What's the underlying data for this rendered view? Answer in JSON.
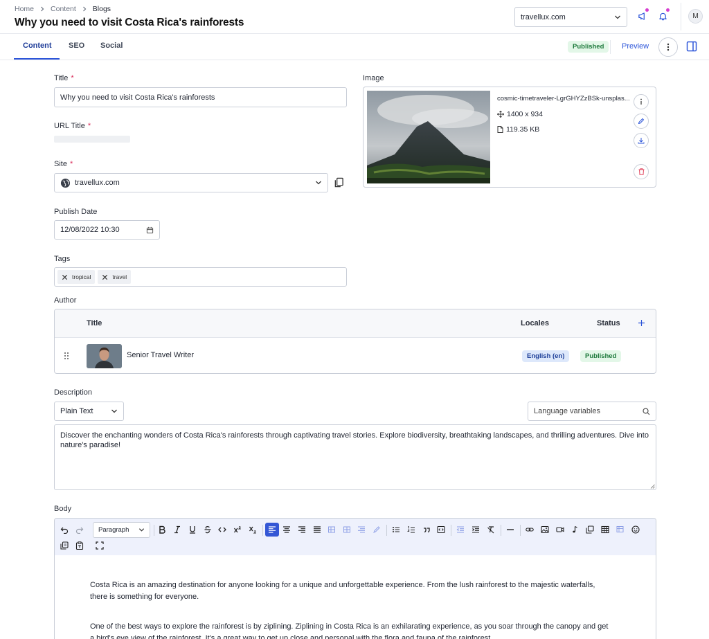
{
  "breadcrumb": [
    "Home",
    "Content",
    "Blogs"
  ],
  "page_title": "Why you need to visit Costa Rica's rainforests",
  "header": {
    "site": "travellux.com",
    "avatar": "M"
  },
  "tabs": [
    {
      "label": "Content",
      "active": true
    },
    {
      "label": "SEO",
      "active": false
    },
    {
      "label": "Social",
      "active": false
    }
  ],
  "status_badge": "Published",
  "preview_label": "Preview",
  "fields": {
    "title_label": "Title",
    "title_value": "Why you need to visit Costa Rica's rainforests",
    "required_mark": "*",
    "url_title_label": "URL Title",
    "site_label": "Site",
    "site_value": "travellux.com",
    "publish_date_label": "Publish Date",
    "publish_date_value": "12/08/2022 10:30",
    "tags_label": "Tags",
    "tags": [
      "tropical",
      "travel"
    ],
    "image_label": "Image",
    "author_label": "Author",
    "description_label": "Description",
    "body_label": "Body"
  },
  "image": {
    "filename": "cosmic-timetraveler-LgrGHYZzBSk-unsplas...",
    "dimensions": "1400 x 934",
    "size": "119.35 KB"
  },
  "author_table": {
    "headers": {
      "title": "Title",
      "locales": "Locales",
      "status": "Status"
    },
    "rows": [
      {
        "title": "Senior Travel Writer",
        "locale": "English (en)",
        "status": "Published"
      }
    ]
  },
  "description": {
    "format": "Plain Text",
    "search_placeholder": "Language variables",
    "text": "Discover the enchanting wonders of Costa Rica's rainforests through captivating travel stories. Explore biodiversity, breathtaking landscapes, and thrilling adventures. Dive into nature's paradise!"
  },
  "editor": {
    "block_format": "Paragraph",
    "paragraphs": [
      "Costa Rica is an amazing destination for anyone looking for a unique and unforgettable experience. From the lush rainforest to the majestic waterfalls, there is something for everyone.",
      "One of the best ways to explore the rainforest is by ziplining. Ziplining in Costa Rica is an exhilarating experience, as you soar through the canopy and get a bird's eye view of the rainforest. It's a great way to get up close and personal with the flora and fauna of the rainforest."
    ]
  },
  "colors": {
    "accent": "#2c55d9",
    "active_tab": "#1f3d99",
    "published_bg": "#e3f7e8",
    "published_fg": "#1f7a3d",
    "required": "#d92d5a",
    "notification_dot": "#d63ccf"
  }
}
